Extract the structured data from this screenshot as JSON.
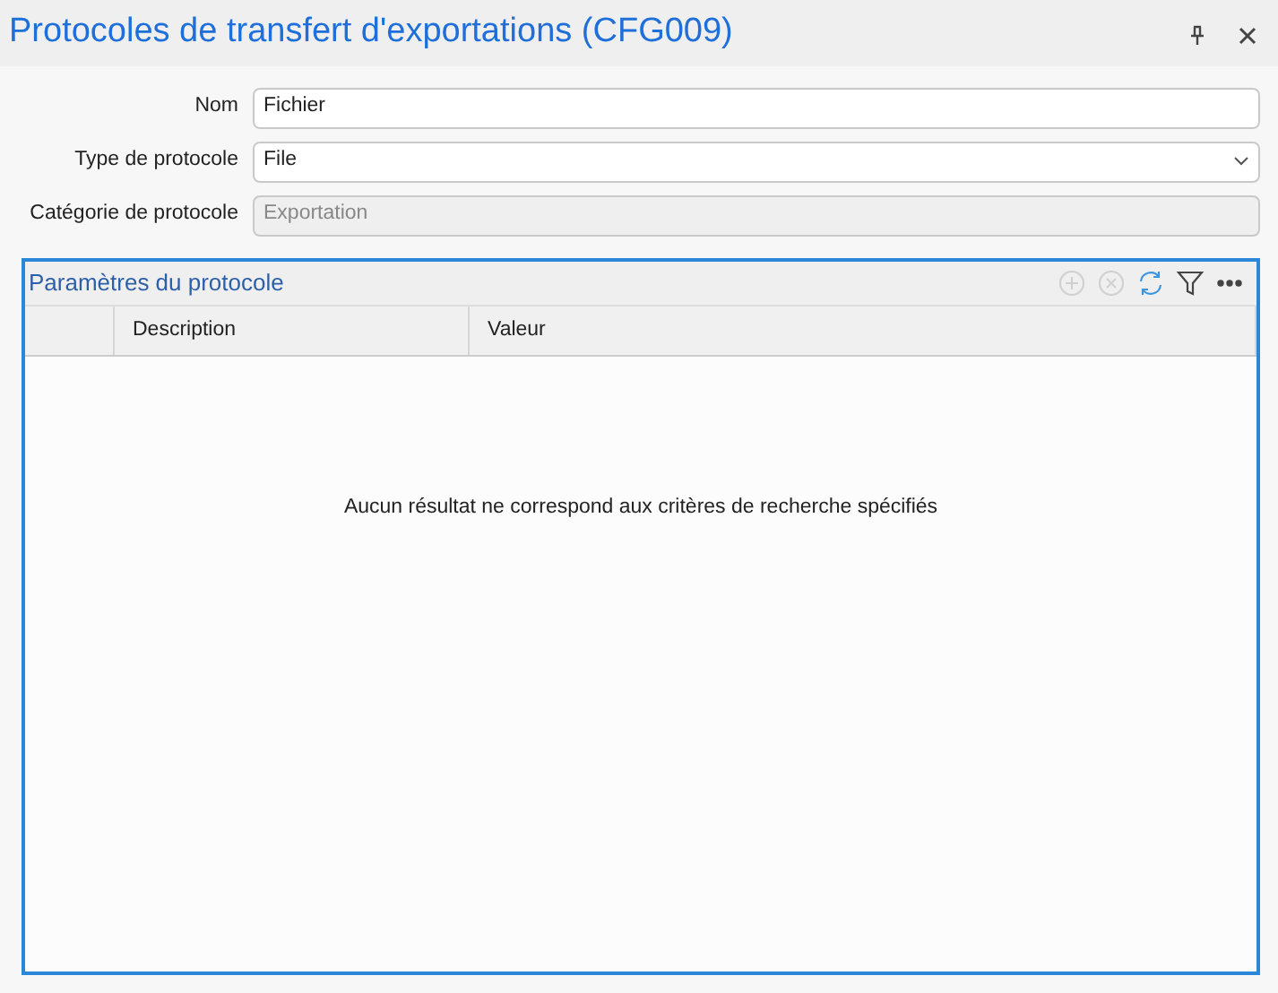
{
  "window": {
    "title": "Protocoles de transfert d'exportations (CFG009)"
  },
  "form": [
    {
      "label": "Nom",
      "kind": "text",
      "value": "Fichier",
      "disabled": false
    },
    {
      "label": "Type de protocole",
      "kind": "select",
      "value": "File",
      "disabled": false
    },
    {
      "label": "Catégorie de protocole",
      "kind": "text",
      "value": "Exportation",
      "disabled": true
    }
  ],
  "panel": {
    "title": "Paramètres du protocole",
    "toolbar": [
      {
        "kind": "add",
        "disabled": true
      },
      {
        "kind": "remove",
        "disabled": true
      },
      {
        "kind": "refresh",
        "disabled": false
      },
      {
        "kind": "filter",
        "disabled": false
      },
      {
        "kind": "more",
        "disabled": false
      }
    ],
    "columns": [
      "Description",
      "Valeur"
    ],
    "empty_message": "Aucun résultat ne correspond aux critères de recherche spécifiés"
  }
}
